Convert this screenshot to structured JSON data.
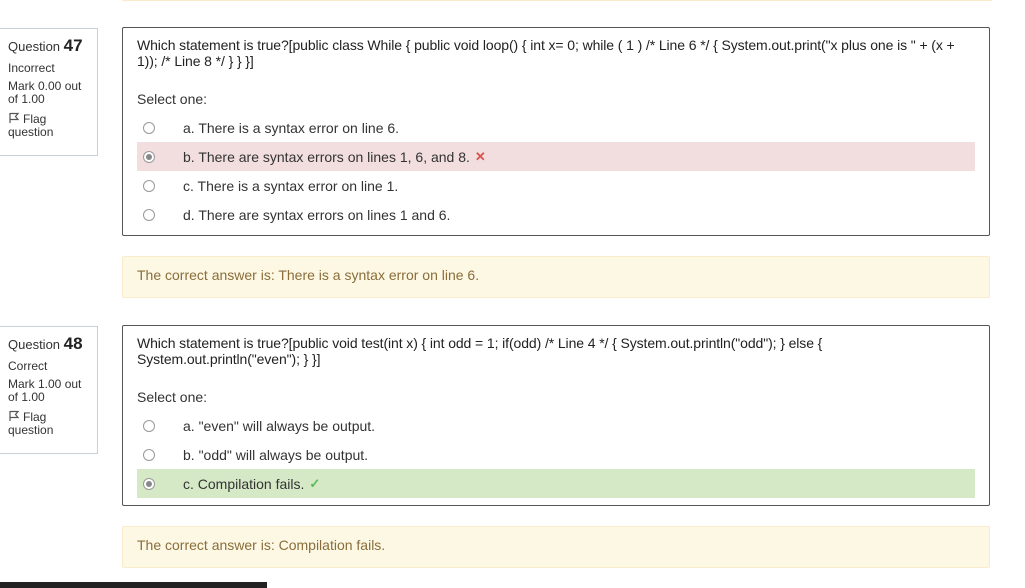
{
  "q47": {
    "label": "Question",
    "number": "47",
    "state": "Incorrect",
    "grade": "Mark 0.00 out of 1.00",
    "flag": "Flag question",
    "text": "Which statement is true?[public class While { public void loop() { int x= 0; while ( 1 ) /* Line 6 */ { System.out.print(\"x plus one is \" + (x + 1)); /* Line 8 */ } } }]",
    "prompt": "Select one:",
    "options": [
      {
        "label": "a. There is a syntax error on line 6.",
        "selected": false,
        "status": ""
      },
      {
        "label": "b. There are syntax errors on lines 1, 6, and 8.",
        "selected": true,
        "status": "incorrect"
      },
      {
        "label": "c. There is a syntax error on line 1.",
        "selected": false,
        "status": ""
      },
      {
        "label": "d. There are syntax errors on lines 1 and 6.",
        "selected": false,
        "status": ""
      }
    ],
    "feedback": "The correct answer is: There is a syntax error on line 6."
  },
  "q48": {
    "label": "Question",
    "number": "48",
    "state": "Correct",
    "grade": "Mark 1.00 out of 1.00",
    "flag": "Flag question",
    "text": "Which statement is true?[public void test(int x) { int odd = 1; if(odd) /* Line 4 */ { System.out.println(\"odd\"); } else { System.out.println(\"even\"); } }]",
    "prompt": "Select one:",
    "options": [
      {
        "label": "a. \"even\" will always be output.",
        "selected": false,
        "status": ""
      },
      {
        "label": "b. \"odd\" will always be output.",
        "selected": false,
        "status": ""
      },
      {
        "label": "c. Compilation fails.",
        "selected": true,
        "status": "correct"
      }
    ],
    "feedback": "The correct answer is: Compilation fails."
  },
  "icons": {
    "flag": "flag-icon",
    "incorrect": "cross-icon",
    "correct": "check-icon"
  },
  "colors": {
    "incorrect_bg": "#f2dede",
    "correct_bg": "#d6e9c6",
    "feedback_bg": "#fcf8e3",
    "feedback_text": "#8a6d3b"
  }
}
